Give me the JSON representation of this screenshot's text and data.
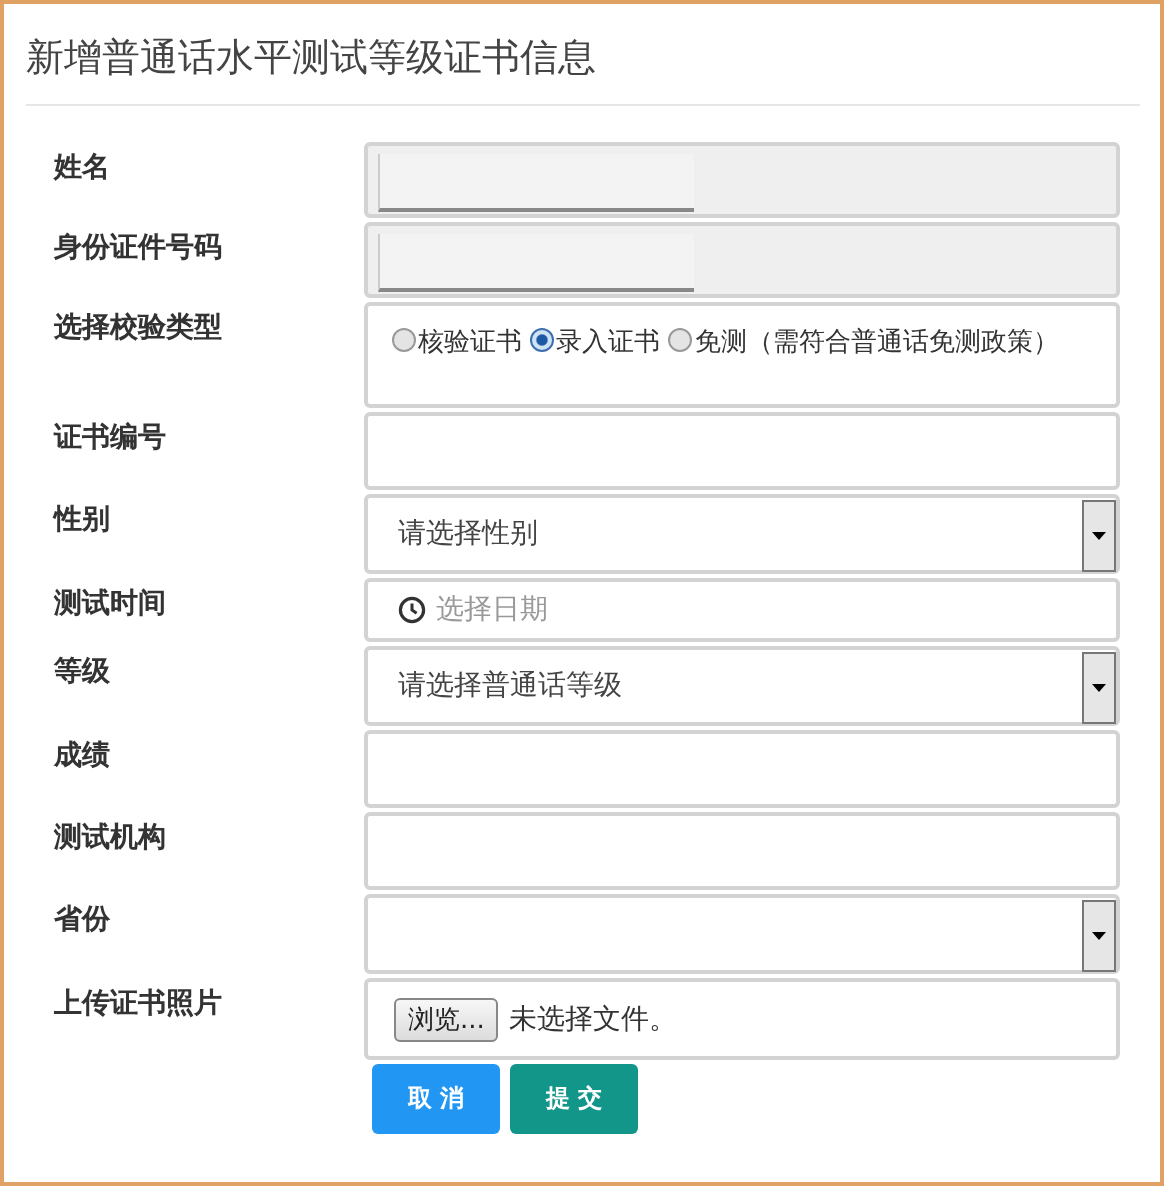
{
  "title": "新增普通话水平测试等级证书信息",
  "fields": [
    {
      "label": "姓名",
      "kind": "readonly"
    },
    {
      "label": "身份证件号码",
      "kind": "readonly"
    },
    {
      "label": "选择校验类型",
      "kind": "radio",
      "options": [
        {
          "label": "核验证书",
          "selected": false
        },
        {
          "label": "录入证书",
          "selected": true
        },
        {
          "label": "免测（需符合普通话免测政策）",
          "selected": false
        }
      ]
    },
    {
      "label": "证书编号",
      "kind": "text"
    },
    {
      "label": "性别",
      "kind": "select",
      "value": "请选择性别"
    },
    {
      "label": "测试时间",
      "kind": "date",
      "placeholder": "选择日期"
    },
    {
      "label": "等级",
      "kind": "select",
      "value": "请选择普通话等级"
    },
    {
      "label": "成绩",
      "kind": "text"
    },
    {
      "label": "测试机构",
      "kind": "text"
    },
    {
      "label": "省份",
      "kind": "select"
    },
    {
      "label": "上传证书照片",
      "kind": "file",
      "button": "浏览...",
      "status": "未选择文件。"
    }
  ],
  "buttons": [
    {
      "label": "取 消",
      "kind": "cancel"
    },
    {
      "label": "提 交",
      "kind": "submit"
    }
  ]
}
